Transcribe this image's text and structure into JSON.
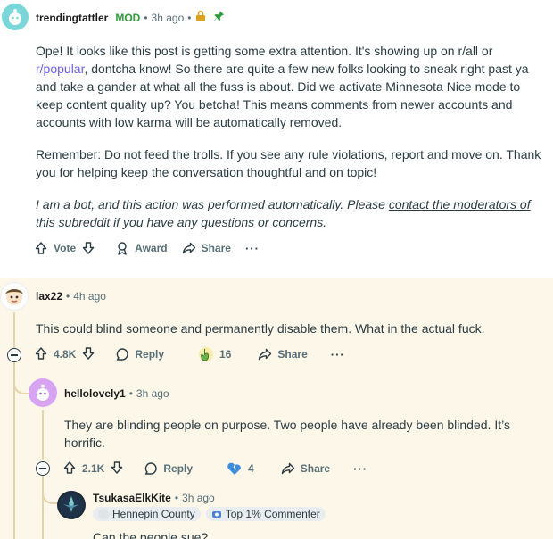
{
  "comments": [
    {
      "username": "trendingtattler",
      "mod_label": "MOD",
      "time": "3h ago",
      "lock_icon": "lock-icon",
      "pin_icon": "pin-icon",
      "paragraphs": {
        "p1_a": "Ope! It looks like this post is getting some extra attention. It's showing up on r/all or ",
        "p1_link": "r/popular",
        "p1_b": ", dontcha know! So there are quite a few new folks looking to sneak right past ya and take a gander at what all the fuss is about. Did we activate Minnesota Nice mode to keep content quality up? You betcha! This means comments from newer accounts and accounts with low karma will be automatically removed.",
        "p2": "Remember: Do not feed the trolls. If you see any rule violations, report and move on. Thank you for helping keep the conversation thoughtful and on topic!",
        "p3_a": "I am a bot, and this action was performed automatically. Please ",
        "p3_link": "contact the moderators of this subreddit",
        "p3_b": " if you have any questions or concerns."
      },
      "actions": {
        "vote_label": "Vote",
        "award_label": "Award",
        "share_label": "Share",
        "more_label": "···"
      }
    },
    {
      "username": "lax22",
      "time": "4h ago",
      "text": "This could blind someone and permanently disable them. What in the actual fuck.",
      "votes": "4.8K",
      "reply_label": "Reply",
      "award_count": "16",
      "share_label": "Share",
      "more_label": "···"
    },
    {
      "username": "hellolovely1",
      "time": "3h ago",
      "text": "They are blinding people on purpose. Two people have already been blinded. It’s horrific.",
      "votes": "2.1K",
      "reply_label": "Reply",
      "award_count": "4",
      "share_label": "Share",
      "more_label": "···"
    },
    {
      "username": "TsukasaElkKite",
      "time": "3h ago",
      "flair1": "Hennepin County",
      "flair2": "Top 1% Commenter",
      "text": "Can the people sue?"
    }
  ],
  "colors": {
    "mod_green": "#2f9e3a",
    "link_purple": "#6a5cff",
    "highlight_bg": "#fdf7e9",
    "muted": "#576f76"
  }
}
